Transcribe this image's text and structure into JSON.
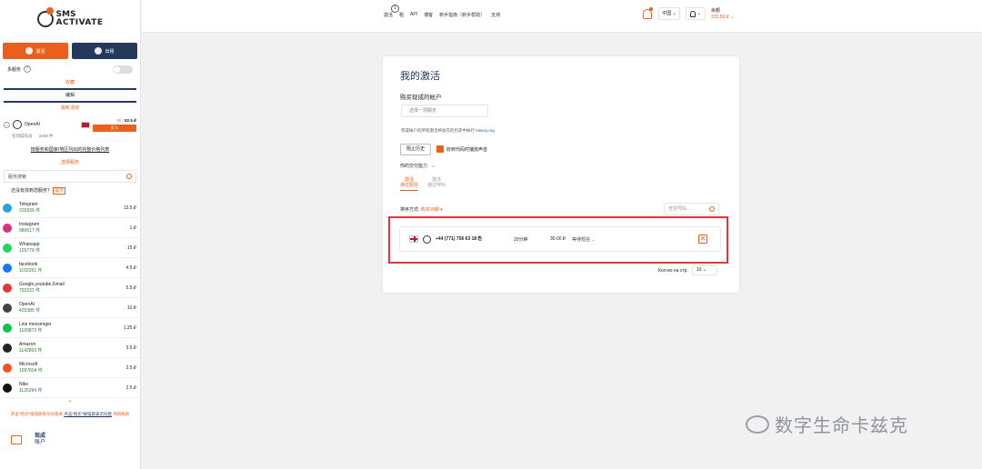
{
  "logo": {
    "line1": "SMS",
    "line2": "ACTIVATE"
  },
  "sidebar": {
    "activate_label": "激活",
    "rent_label": "出租",
    "multi_service_label": "多服务",
    "help_glyph": "?",
    "favorites_label": "收藏",
    "edit_label": "编辑",
    "promo_label": "最新活动",
    "promo_item": {
      "name": "OpenAI",
      "old_price": "55 / ",
      "price": "82.5 ₽",
      "buy_label": "买入",
      "sub1": "任何操作员",
      "sub2": "2468 件"
    },
    "full_price_link": "按服务和国家/地区列出的完整价格列表",
    "choose_service_label": "选择服务",
    "search_placeholder": "服务搜索",
    "not_found_text": "还没有找到您服务？",
    "not_found_hint": "提示",
    "services": [
      {
        "name": "Telegram",
        "count": "225939 件",
        "price": "13.5 ₽",
        "color": "#2aa3dd"
      },
      {
        "name": "Instagram",
        "count": "980617 件",
        "price": "1 ₽",
        "color": "#d6317a"
      },
      {
        "name": "Whatsapp",
        "count": "125779 件",
        "price": "15 ₽",
        "color": "#25d366"
      },
      {
        "name": "facebook",
        "count": "1102261 件",
        "price": "4.5 ₽",
        "color": "#1877f2"
      },
      {
        "name": "Google,youtube,Gmail",
        "count": "792223 件",
        "price": "5.5 ₽",
        "color": "#e53935"
      },
      {
        "name": "OpenAI",
        "count": "425385 件",
        "price": "10 ₽",
        "color": "#444444"
      },
      {
        "name": "Line messenger",
        "count": "1109873 件",
        "price": "1.25 ₽",
        "color": "#06c755"
      },
      {
        "name": "Amazon",
        "count": "1142863 件",
        "price": "3.5 ₽",
        "color": "#222222"
      },
      {
        "name": "Microsoft",
        "count": "1097604 件",
        "price": "2.5 ₽",
        "color": "#f25022"
      },
      {
        "name": "Nike",
        "count": "1135294 件",
        "price": "2.5 ₽",
        "color": "#111111"
      }
    ],
    "expand_glyph": "⌄",
    "foot_note_a": "单击\"购买\"按钮即表示同意本",
    "foot_note_b": "点击\"购买\"按钮即表示同意",
    "foot_note_c": "项目规则",
    "cart_title": "现成",
    "cart_sub": "账户"
  },
  "topbar": {
    "nav": [
      "激活",
      "租",
      "API",
      "博客",
      "新手指南（新手帮助）",
      "支持"
    ],
    "badge_count": "1",
    "lang": "中国 ⌄",
    "user_chev": "⌄",
    "balance_label": "余额",
    "balance_value": "223.50 ₽ ⌄"
  },
  "main": {
    "title": "我的激活",
    "buy_ready": "购买现成的帐户",
    "select_service_placeholder": "选择一项服务",
    "history_note": "完成帐户的所有激活将会在的历史中执行 ",
    "history_link": "history.org",
    "history_btn": "阻止历史",
    "sound_label": "收到代码时播放声音",
    "delivery_label": "你的交付能力",
    "delivery_chev": "⌄",
    "tabs": [
      {
        "l1": "激活",
        "l2": "通过短信"
      },
      {
        "l1": "激活",
        "l2": "通过呼叫"
      }
    ],
    "sort_label": "排序方式: ",
    "sort_value": "购买日期 ▾",
    "search_placeholder": "查找号码...",
    "activation": {
      "number": "+44 (771) 756 63 18",
      "copy_glyph": "⎘",
      "time": "20分钟",
      "price": "30.00 ₽",
      "status": "等待短信 ",
      "status_chev": "⌄",
      "cancel_glyph": "✕"
    },
    "per_page_label": "Кол-во на стр.",
    "per_page_value": "10 ⌄"
  },
  "watermark": "数字生命卡兹克"
}
